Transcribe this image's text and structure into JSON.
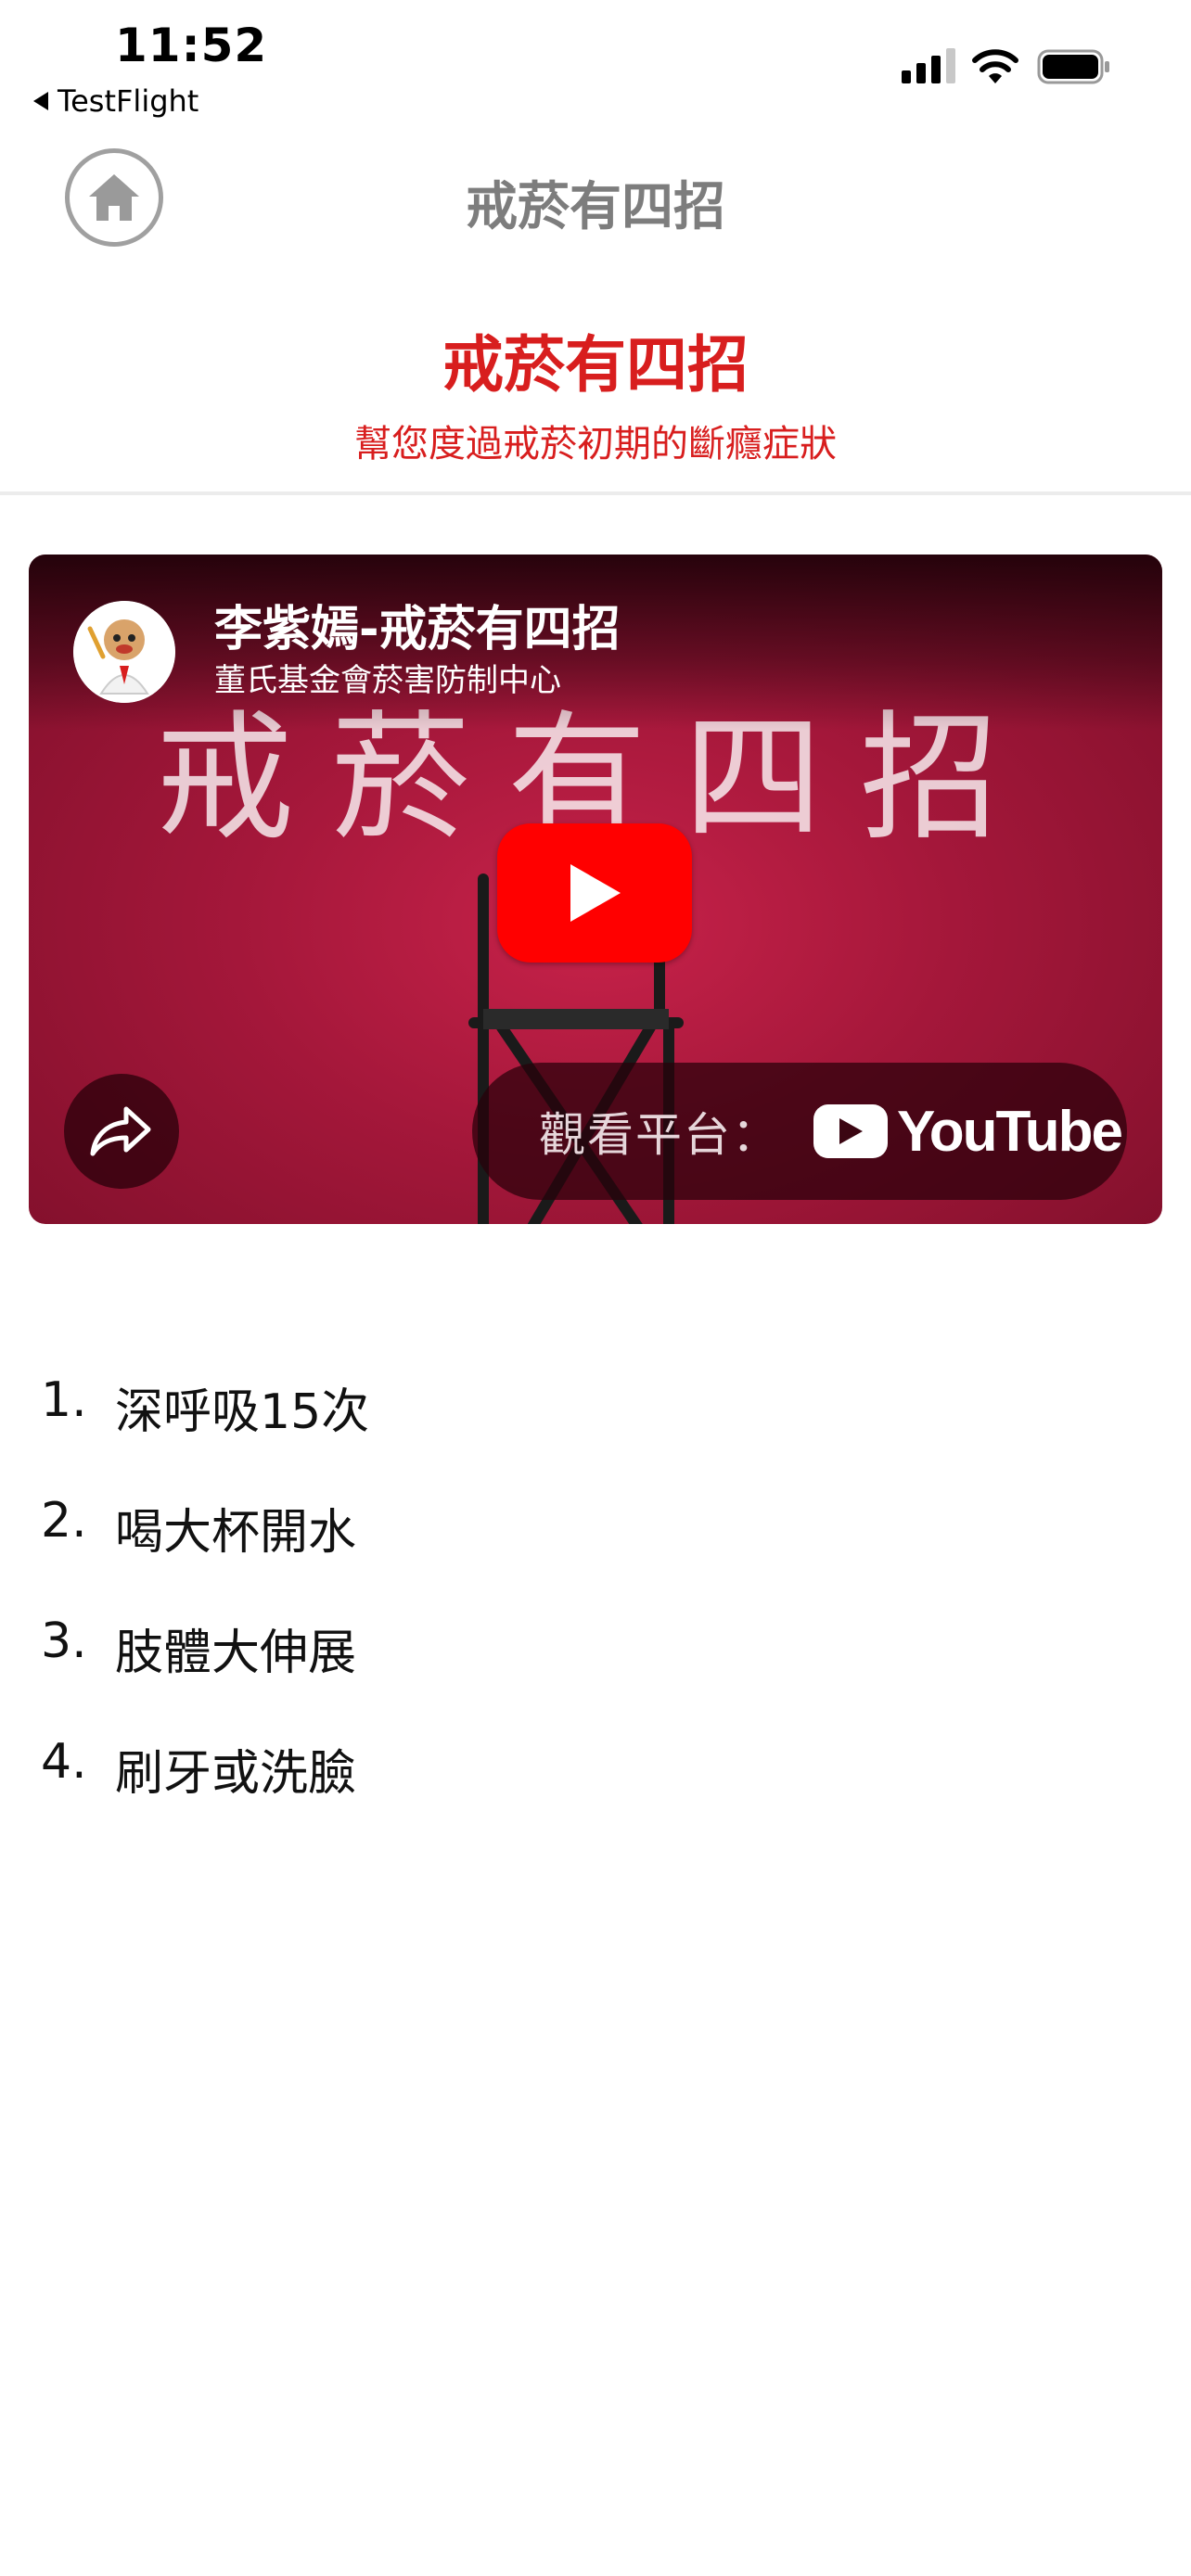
{
  "status_bar": {
    "time": "11:52",
    "back_label": "TestFlight",
    "signal_icon": "cellular-signal-icon",
    "wifi_icon": "wifi-icon",
    "battery_icon": "battery-icon"
  },
  "nav": {
    "title": "戒菸有四招",
    "home_icon": "home-icon"
  },
  "header": {
    "title": "戒菸有四招",
    "subtitle": "幫您度過戒菸初期的斷癮症狀",
    "accent_color": "#d81e1e"
  },
  "video": {
    "title": "李紫嫣-戒菸有四招",
    "channel": "董氏基金會菸害防制中心",
    "overlay_text": "戒菸有四招",
    "watch_on_label": "觀看平台：",
    "platform_name": "YouTube",
    "play_icon": "play-icon",
    "share_icon": "share-icon"
  },
  "tips": [
    {
      "number": "1.",
      "text": "深呼吸15次"
    },
    {
      "number": "2.",
      "text": "喝大杯開水"
    },
    {
      "number": "3.",
      "text": "肢體大伸展"
    },
    {
      "number": "4.",
      "text": "刷牙或洗臉"
    }
  ]
}
